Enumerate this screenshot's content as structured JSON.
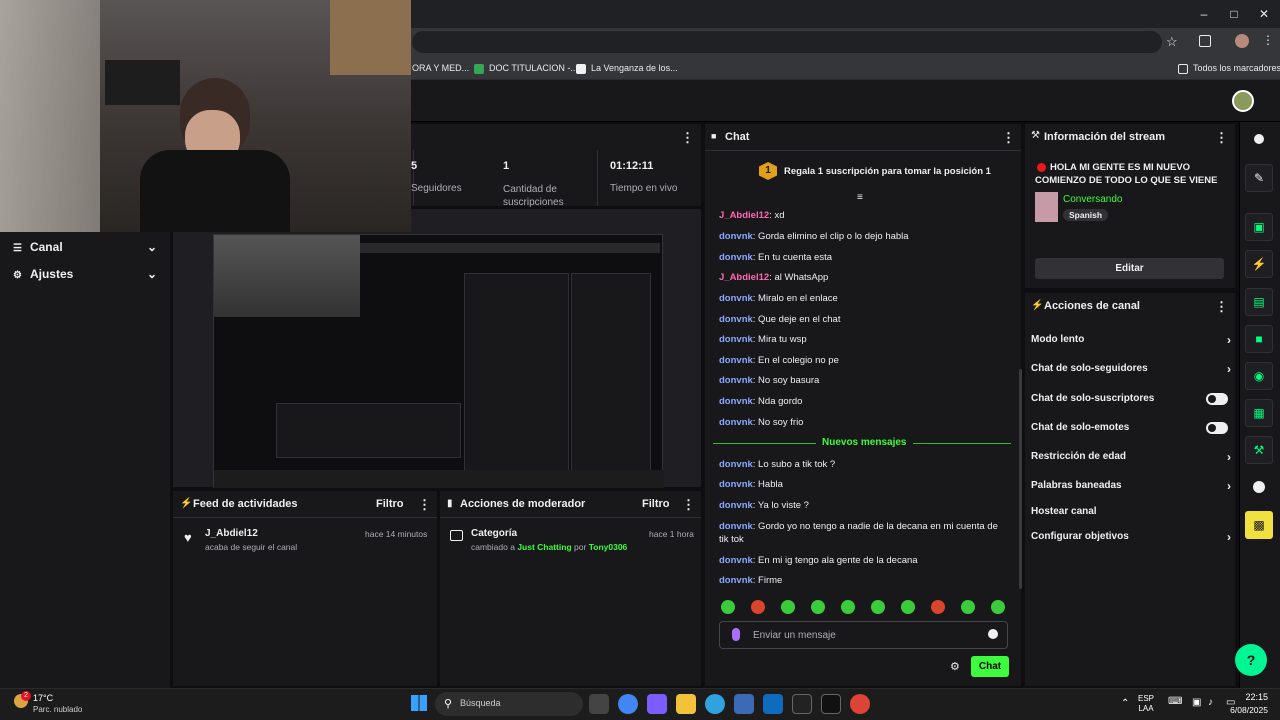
{
  "browser": {
    "bookmarks": [
      {
        "label": "ORA Y MED..."
      },
      {
        "label": "DOC TITULACION -..."
      },
      {
        "label": "La Venganza de los..."
      }
    ],
    "all_bookmarks": "Todos los marcadores"
  },
  "sidebar_left": {
    "items": [
      {
        "label": "Canal"
      },
      {
        "label": "Ajustes"
      }
    ]
  },
  "stats": {
    "items": [
      {
        "value": "5",
        "label": "Seguidores"
      },
      {
        "value": "1",
        "label": "Cantidad de suscripciones"
      },
      {
        "value": "01:12:11",
        "label": "Tiempo en vivo"
      }
    ]
  },
  "activity": {
    "title": "Feed de actividades",
    "filter": "Filtro",
    "items": [
      {
        "user": "J_Abdiel12",
        "desc": "acaba de seguir el canal",
        "time": "hace 14 minutos"
      }
    ]
  },
  "modactions": {
    "title": "Acciones de moderador",
    "filter": "Filtro",
    "items": [
      {
        "title": "Categoría",
        "desc_prefix": "cambiado a",
        "category": "Just Chatting",
        "by": "por",
        "mod": "Tony0306",
        "time": "hace 1 hora"
      }
    ]
  },
  "chat": {
    "title": "Chat",
    "pinned": "Regala 1 suscripción para tomar la posición 1",
    "pinned_badge": "1",
    "divider": "Nuevos mensajes",
    "messages_before": [
      {
        "user": "J_Abdiel12",
        "text": "xd",
        "color": "#ff69b4"
      },
      {
        "user": "donvnk",
        "text": "Gorda elimino el clip o lo dejo habla",
        "color": "#8aa8ff"
      },
      {
        "user": "donvnk",
        "text": "En tu cuenta esta",
        "color": "#8aa8ff"
      },
      {
        "user": "J_Abdiel12",
        "text": "al WhatsApp",
        "color": "#ff69b4"
      },
      {
        "user": "donvnk",
        "text": "Miralo en el enlace",
        "color": "#8aa8ff"
      },
      {
        "user": "donvnk",
        "text": "Que deje en el chat",
        "color": "#8aa8ff"
      },
      {
        "user": "donvnk",
        "text": "Mira tu wsp",
        "color": "#8aa8ff"
      },
      {
        "user": "donvnk",
        "text": "En el colegio no pe",
        "color": "#8aa8ff"
      },
      {
        "user": "donvnk",
        "text": "No soy basura",
        "color": "#8aa8ff"
      },
      {
        "user": "donvnk",
        "text": "Nda gordo",
        "color": "#8aa8ff"
      },
      {
        "user": "donvnk",
        "text": "No soy frio",
        "color": "#8aa8ff"
      }
    ],
    "messages_after": [
      {
        "user": "donvnk",
        "text": "Lo subo a tik tok ?"
      },
      {
        "user": "donvnk",
        "text": "Habla"
      },
      {
        "user": "donvnk",
        "text": "Ya lo viste ?"
      },
      {
        "user": "donvnk",
        "text": "Gordo yo no tengo a nadie de la decana en mi cuenta de tik tok"
      },
      {
        "user": "donvnk",
        "text": "En mi ig tengo ala gente de la decana"
      },
      {
        "user": "donvnk",
        "text": "Firme"
      }
    ],
    "input_placeholder": "Enviar un mensaje",
    "send_label": "Chat"
  },
  "stream_info": {
    "title": "Información del stream",
    "stream_title": "HOLA MI GENTE ES MI NUEVO COMIENZO DE TODO LO QUE SE VIENE",
    "category": "Conversando",
    "language": "Spanish",
    "edit_label": "Editar"
  },
  "channel_actions": {
    "title": "Acciones de canal",
    "rows": [
      {
        "label": "Modo lento",
        "kind": "chevron"
      },
      {
        "label": "Chat de solo-seguidores",
        "kind": "chevron"
      },
      {
        "label": "Chat de solo-suscriptores",
        "kind": "toggle"
      },
      {
        "label": "Chat de solo-emotes",
        "kind": "toggle"
      },
      {
        "label": "Restricción de edad",
        "kind": "chevron"
      },
      {
        "label": "Palabras baneadas",
        "kind": "chevron"
      },
      {
        "label": "Hostear canal",
        "kind": "none"
      },
      {
        "label": "Configurar objetivos",
        "kind": "chevron"
      }
    ]
  },
  "taskbar": {
    "weather_temp": "17°C",
    "weather_desc": "Parc. nublado",
    "search": "Búsqueda",
    "lang1": "ESP",
    "lang2": "LAA",
    "time": "22:15",
    "date": "6/08/2025",
    "notif_count": "2"
  },
  "colors": {
    "accent": "#00f593",
    "twitch_green": "#3dfc3d",
    "bg": "#18181b"
  }
}
